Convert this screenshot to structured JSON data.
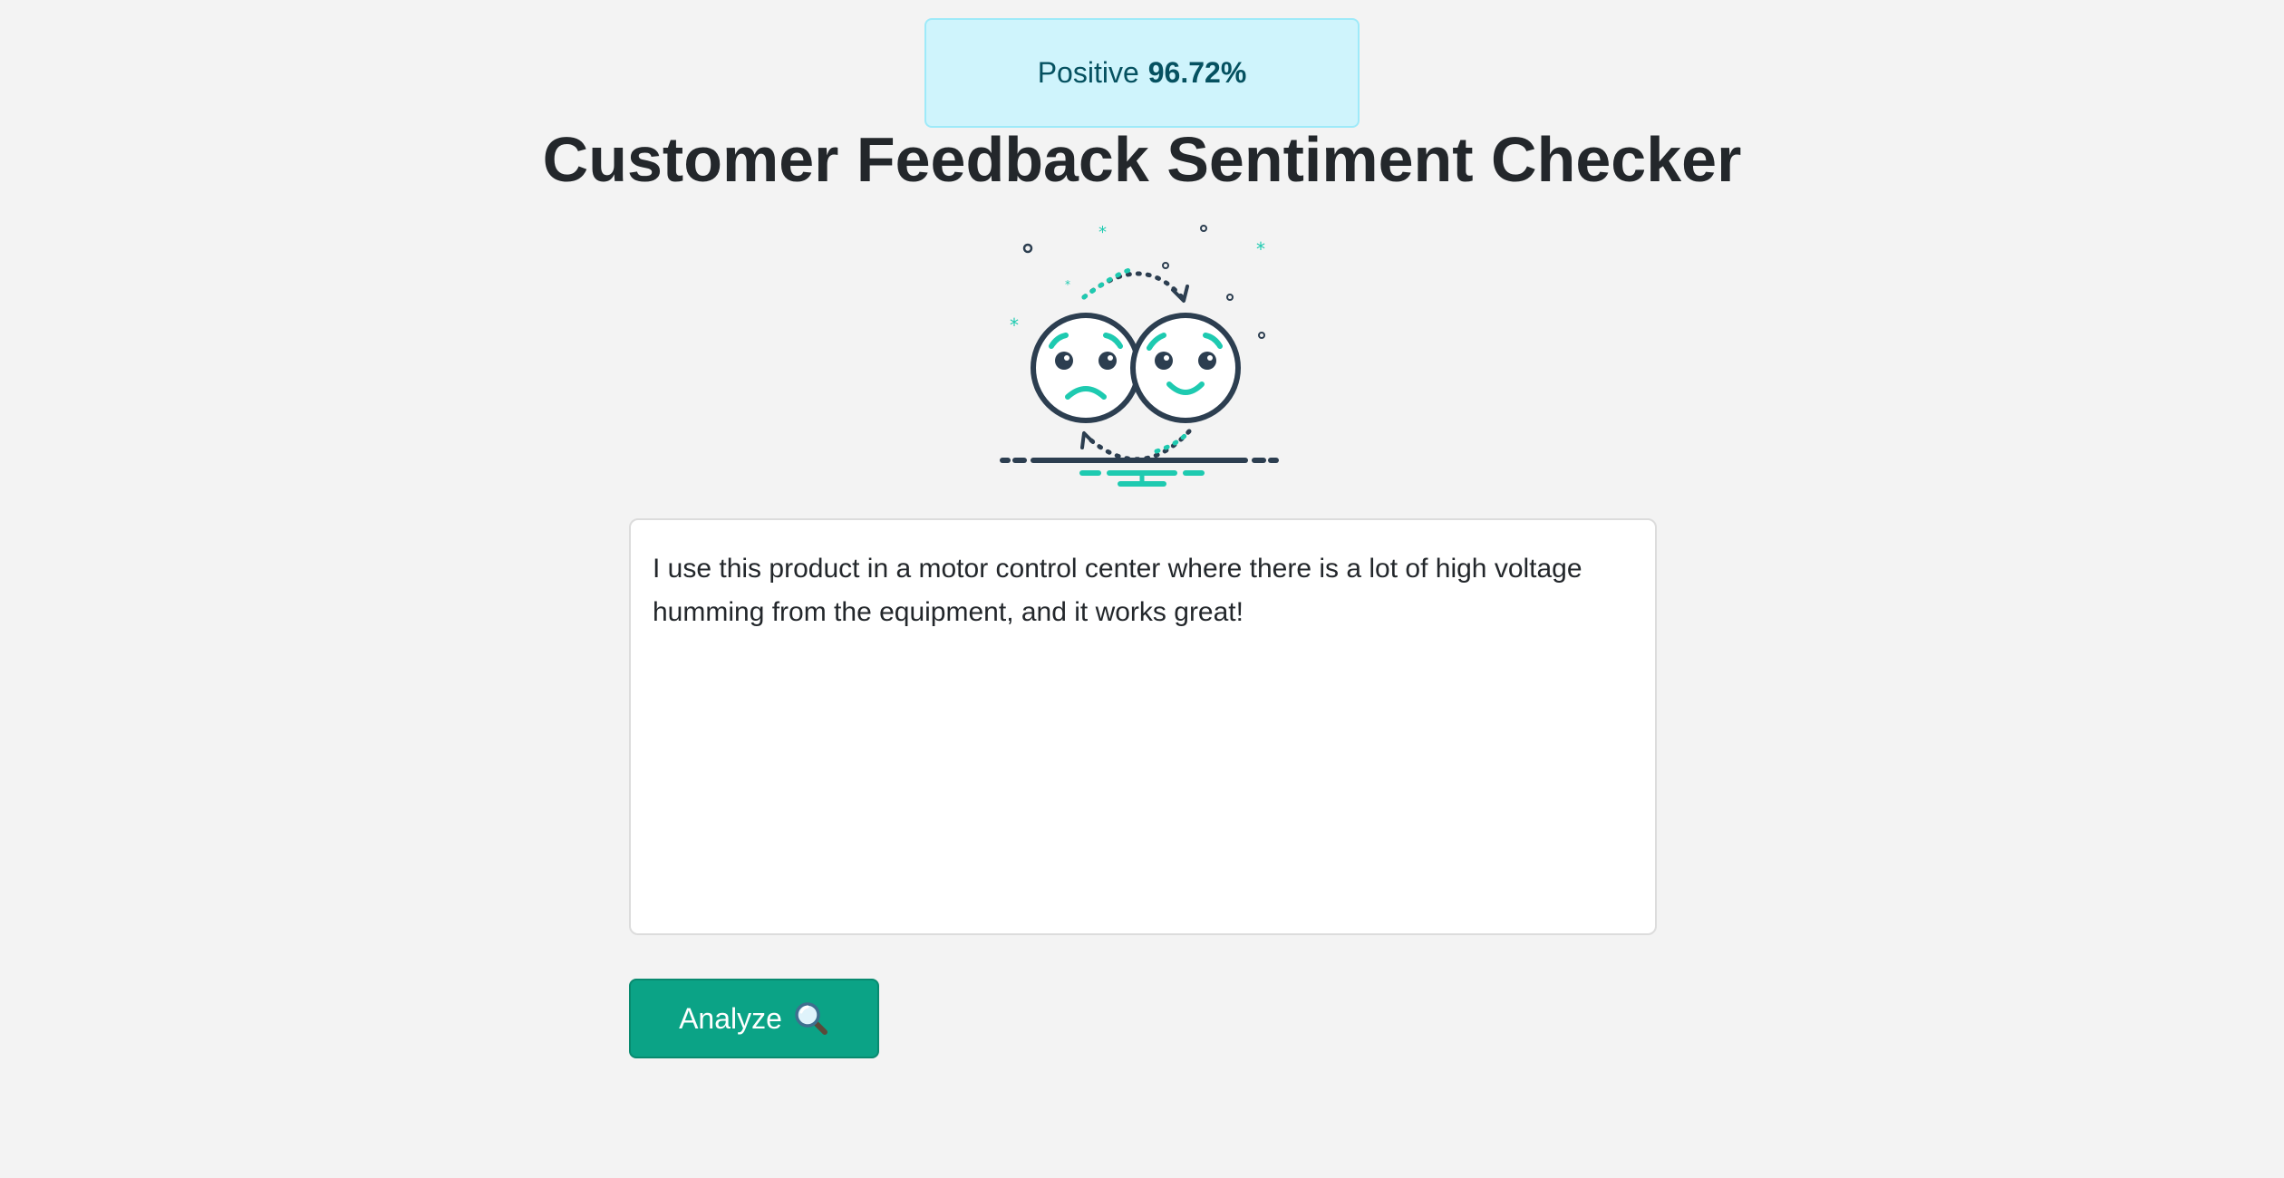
{
  "result": {
    "label": "Positive",
    "score": "96.72%"
  },
  "page": {
    "title": "Customer Feedback Sentiment Checker"
  },
  "illustration": {
    "icon": "sad-to-happy-faces-icon",
    "colors": {
      "outline": "#2c3e50",
      "accent": "#1ecab0"
    }
  },
  "feedback": {
    "value": "I use this product in a motor control center where there is a lot of high voltage humming from the equipment, and it works great!"
  },
  "actions": {
    "analyze_label": "Analyze"
  },
  "colors": {
    "background": "#f3f3f3",
    "alert_bg": "#cff4fc",
    "alert_text": "#055160",
    "button": "#0ba386"
  }
}
